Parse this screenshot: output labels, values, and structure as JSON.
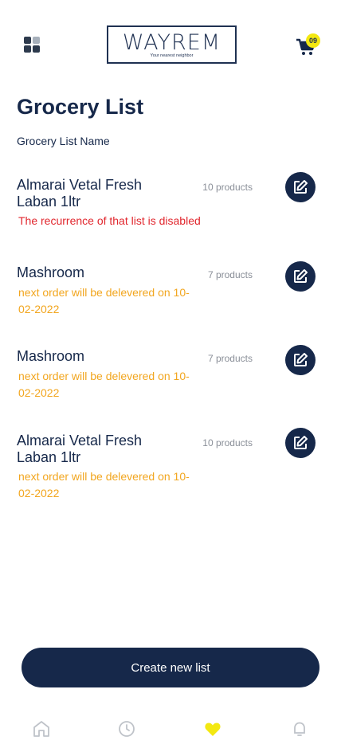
{
  "header": {
    "logo_text": "WAYREM",
    "logo_tagline": "Your nearest neighbor",
    "cart_count": "09",
    "icons": {
      "menu": "grid-menu-icon",
      "cart": "cart-icon"
    }
  },
  "page": {
    "title": "Grocery List",
    "section_label": "Grocery List Name"
  },
  "lists": [
    {
      "name": "Almarai Vetal Fresh Laban 1ltr",
      "count": "10 products",
      "status": "The recurrence of that list is disabled",
      "status_type": "disabled"
    },
    {
      "name": "Mashroom",
      "count": "7 products",
      "status": "next order will be delevered on 10-02-2022",
      "status_type": "next"
    },
    {
      "name": "Mashroom",
      "count": "7 products",
      "status": "next order will be delevered on 10-02-2022",
      "status_type": "next"
    },
    {
      "name": "Almarai Vetal Fresh Laban 1ltr",
      "count": "10 products",
      "status": "next order will be delevered on 10-02-2022",
      "status_type": "next"
    }
  ],
  "actions": {
    "create_label": "Create new list"
  },
  "tabs": [
    {
      "name": "home",
      "icon": "home-icon"
    },
    {
      "name": "history",
      "icon": "clock-icon"
    },
    {
      "name": "favorites",
      "icon": "heart-icon",
      "active": true
    },
    {
      "name": "notifications",
      "icon": "bell-icon"
    }
  ],
  "colors": {
    "primary": "#16284a",
    "accent": "#f3e811",
    "disabled_text": "#e1262d",
    "next_text": "#f2a61f"
  }
}
